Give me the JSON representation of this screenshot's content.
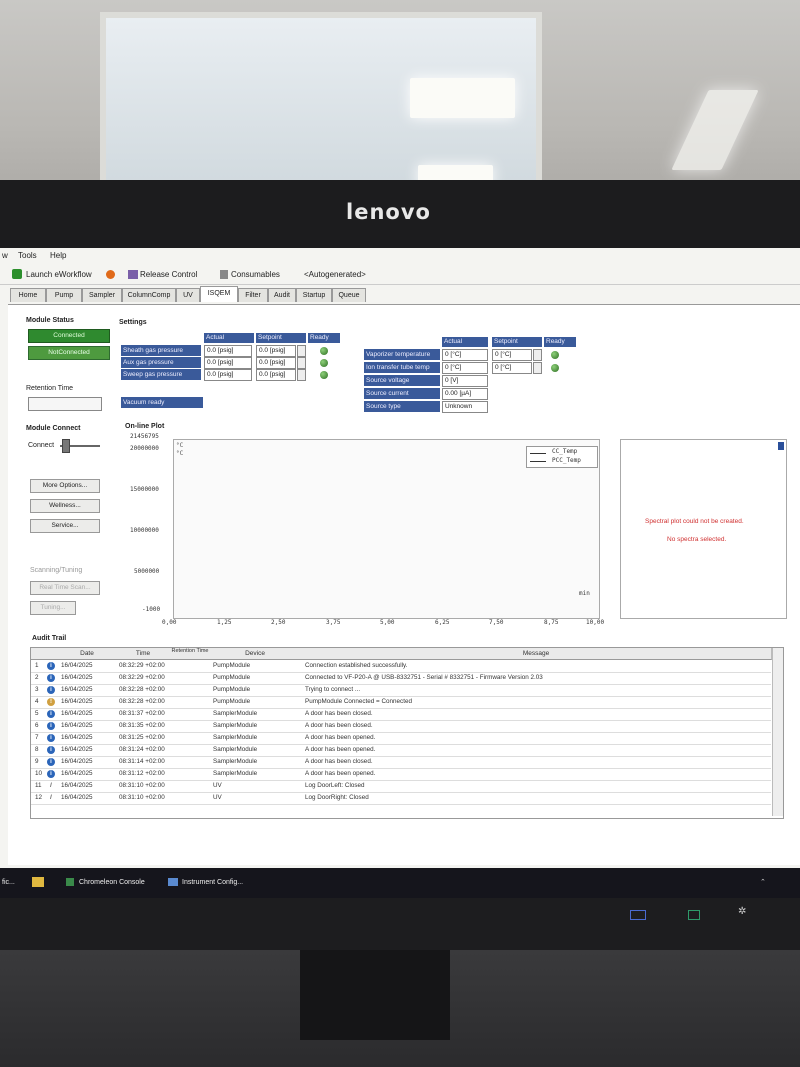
{
  "monitor": {
    "brand": "lenovo"
  },
  "menu": {
    "items": [
      "w",
      "Tools",
      "Help"
    ]
  },
  "toolbar": {
    "launch": "Launch eWorkflow",
    "release": "Release Control",
    "consumables": "Consumables",
    "autogenerated": "<Autogenerated>"
  },
  "tabs": [
    "Home",
    "Pump",
    "Sampler",
    "ColumnComp",
    "UV",
    "ISQEM",
    "Filter",
    "Audit",
    "Startup",
    "Queue"
  ],
  "module_status": {
    "title": "Module Status",
    "connected": "Connected",
    "not_connected": "NotConnected",
    "retention_label": "Retention Time"
  },
  "module_connect": {
    "title": "Module Connect",
    "connect_label": "Connect"
  },
  "buttons": {
    "more_options": "More Options...",
    "wellness": "Wellness...",
    "service": "Service..."
  },
  "scanning": {
    "title": "Scanning/Tuning",
    "realtime": "Real Time Scan...",
    "tuning": "Tuning..."
  },
  "settings": {
    "title": "Settings",
    "headers": [
      "Actual",
      "Setpoint",
      "Ready"
    ],
    "rows": [
      {
        "label": "Sheath gas pressure",
        "actual": "0.0 [psig]",
        "setpoint": "0.0 [psig]"
      },
      {
        "label": "Aux gas pressure",
        "actual": "0.0 [psig]",
        "setpoint": "0.0 [psig]"
      },
      {
        "label": "Sweep gas pressure",
        "actual": "0.0 [psig]",
        "setpoint": "0.0 [psig]"
      }
    ],
    "vacuum": "Vacuum ready"
  },
  "source": {
    "headers": [
      "Actual",
      "Setpoint",
      "Ready"
    ],
    "rows": [
      {
        "label": "Vaporizer temperature",
        "actual": "0 [°C]",
        "setpoint": "0 [°C]"
      },
      {
        "label": "Ion transfer tube temp",
        "actual": "0 [°C]",
        "setpoint": "0 [°C]"
      },
      {
        "label": "Source voltage",
        "actual": "0 [V]",
        "setpoint": ""
      },
      {
        "label": "Source current",
        "actual": "0.00 [µA]",
        "setpoint": ""
      },
      {
        "label": "Source type",
        "actual": "Unknown",
        "setpoint": ""
      }
    ]
  },
  "plot": {
    "title": "On-line Plot",
    "y_ticks": [
      "21456795",
      "20000000",
      "15000000",
      "10000000",
      "5000000",
      "-1000"
    ],
    "x_ticks": [
      "0,00",
      "1,25",
      "2,50",
      "3,75",
      "5,00",
      "6,25",
      "7,50",
      "8,75",
      "10,00"
    ],
    "x_unit": "min",
    "y_units": [
      "°C",
      "°C"
    ],
    "legend": [
      "CC_Temp",
      "PCC_Temp"
    ]
  },
  "spectral": {
    "line1": "Spectral plot could not be created.",
    "line2": "No spectra selected."
  },
  "audit": {
    "title": "Audit Trail",
    "columns": [
      "Date",
      "Time",
      "Retention Time",
      "Device",
      "Message"
    ],
    "rows": [
      [
        "1",
        "16/04/2025",
        "08:32:29 +02:00",
        "PumpModule",
        "Connection established successfully."
      ],
      [
        "2",
        "16/04/2025",
        "08:32:29 +02:00",
        "PumpModule",
        "Connected to VF-P20-A @ USB-8332751 - Serial # 8332751 - Firmware Version 2.03"
      ],
      [
        "3",
        "16/04/2025",
        "08:32:28 +02:00",
        "PumpModule",
        "Trying to connect ..."
      ],
      [
        "4",
        "16/04/2025",
        "08:32:28 +02:00",
        "PumpModule",
        "PumpModule Connected = Connected"
      ],
      [
        "5",
        "16/04/2025",
        "08:31:37 +02:00",
        "SamplerModule",
        "A door has been closed."
      ],
      [
        "6",
        "16/04/2025",
        "08:31:35 +02:00",
        "SamplerModule",
        "A door has been closed."
      ],
      [
        "7",
        "16/04/2025",
        "08:31:25 +02:00",
        "SamplerModule",
        "A door has been opened."
      ],
      [
        "8",
        "16/04/2025",
        "08:31:24 +02:00",
        "SamplerModule",
        "A door has been opened."
      ],
      [
        "9",
        "16/04/2025",
        "08:31:14 +02:00",
        "SamplerModule",
        "A door has been closed."
      ],
      [
        "10",
        "16/04/2025",
        "08:31:12 +02:00",
        "SamplerModule",
        "A door has been opened."
      ],
      [
        "11",
        "16/04/2025",
        "08:31:10 +02:00",
        "UV",
        "Log DoorLeft: Closed"
      ],
      [
        "12",
        "16/04/2025",
        "08:31:10 +02:00",
        "UV",
        "Log DoorRight: Closed"
      ]
    ]
  },
  "taskbar": {
    "items": [
      "fic...",
      "Chromeleon Console",
      "Instrument Config..."
    ]
  }
}
